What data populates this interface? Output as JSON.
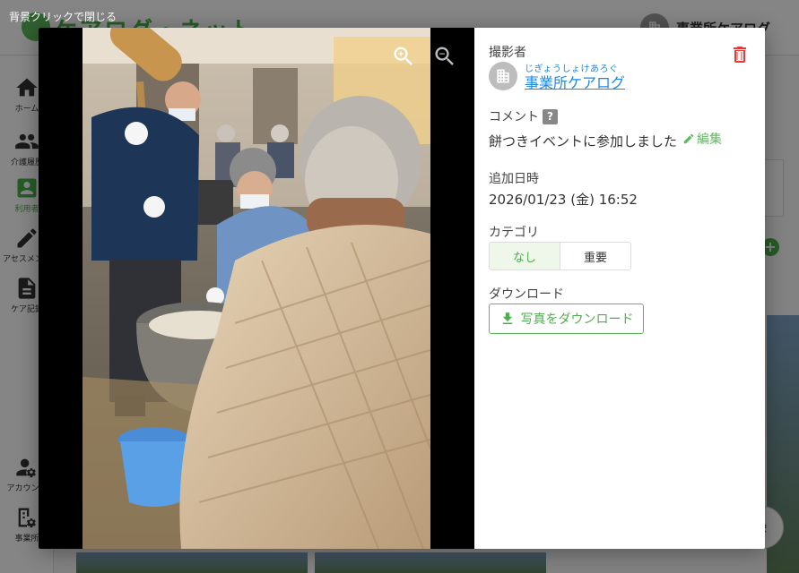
{
  "app": {
    "title": "ケアログ・ネット",
    "user_name": "事業所ケアログ",
    "sidebar": [
      {
        "label": "ホーム",
        "icon": "home-icon"
      },
      {
        "label": "介護履歴",
        "icon": "people-icon"
      },
      {
        "label": "利用者",
        "icon": "user-badge-icon"
      },
      {
        "label": "アセスメント",
        "icon": "edit-note-icon"
      },
      {
        "label": "ケア記録",
        "icon": "document-icon"
      },
      {
        "label": "アカウント",
        "icon": "account-settings-icon"
      },
      {
        "label": "事業所",
        "icon": "office-settings-icon"
      }
    ],
    "fab_label": "択"
  },
  "overlay": {
    "close_hint": "背景クリックで閉じる"
  },
  "modal": {
    "photo_alt": "餅つきイベントの写真",
    "photographer_label": "撮影者",
    "photographer_ruby": "じぎょうしょけあろぐ",
    "photographer_name": "事業所ケアログ",
    "comment_label": "コメント",
    "comment_help": "?",
    "comment_text": "餅つきイベントに参加しました",
    "edit_label": "編集",
    "added_label": "追加日時",
    "added_value": "2026/01/23 (金) 16:52",
    "category_label": "カテゴリ",
    "category_options": [
      "なし",
      "重要"
    ],
    "category_selected": "なし",
    "download_label": "ダウンロード",
    "download_button": "写真をダウンロード"
  },
  "colors": {
    "accent": "#5cb85c",
    "link": "#1e88e5",
    "danger": "#e53935"
  }
}
